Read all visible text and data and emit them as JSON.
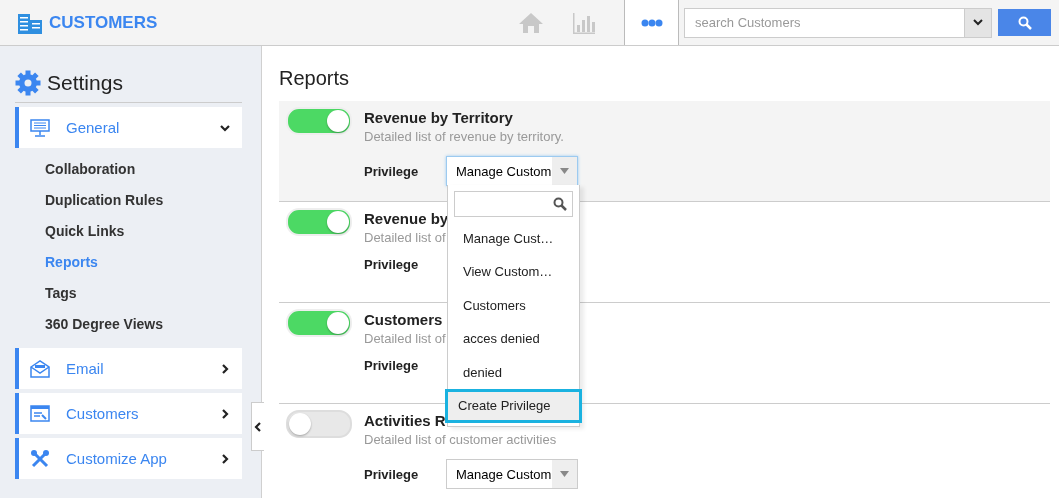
{
  "header": {
    "app_title": "CUSTOMERS",
    "search": {
      "placeholder": "search Customers"
    }
  },
  "sidebar": {
    "title": "Settings",
    "sections": [
      {
        "label": "General",
        "kind": "monitor",
        "expanded": true,
        "children": [
          {
            "label": "Collaboration",
            "selected": false
          },
          {
            "label": "Duplication Rules",
            "selected": false
          },
          {
            "label": "Quick Links",
            "selected": false
          },
          {
            "label": "Reports",
            "selected": true
          },
          {
            "label": "Tags",
            "selected": false
          },
          {
            "label": "360 Degree Views",
            "selected": false
          }
        ]
      },
      {
        "label": "Email",
        "kind": "email",
        "expanded": false
      },
      {
        "label": "Customers",
        "kind": "window",
        "expanded": false
      },
      {
        "label": "Customize App",
        "kind": "tools",
        "expanded": false
      }
    ]
  },
  "reports": {
    "title": "Reports",
    "rows": [
      {
        "name": "Revenue by Territory",
        "description": "Detailed list of revenue by territory.",
        "on": true,
        "highlighted": true,
        "privilege_label": "Privilege",
        "privilege": "Manage Custom"
      },
      {
        "name": "Revenue by",
        "description": "Detailed list of",
        "on": true,
        "highlighted": false,
        "privilege_label": "Privilege"
      },
      {
        "name": "Customers",
        "description": "Detailed list of",
        "on": true,
        "highlighted": false,
        "privilege_label": "Privilege"
      },
      {
        "name": "Activities R",
        "description": "Detailed list of customer activities",
        "on": false,
        "highlighted": false,
        "privilege_label": "Privilege",
        "privilege": "Manage Custom"
      }
    ],
    "dropdown": {
      "options": [
        {
          "label": "Manage Cust…"
        },
        {
          "label": "View Custom…"
        },
        {
          "label": "Customers"
        },
        {
          "label": "acces denied"
        },
        {
          "label": "denied"
        }
      ],
      "create_label": "Create Privilege"
    }
  }
}
